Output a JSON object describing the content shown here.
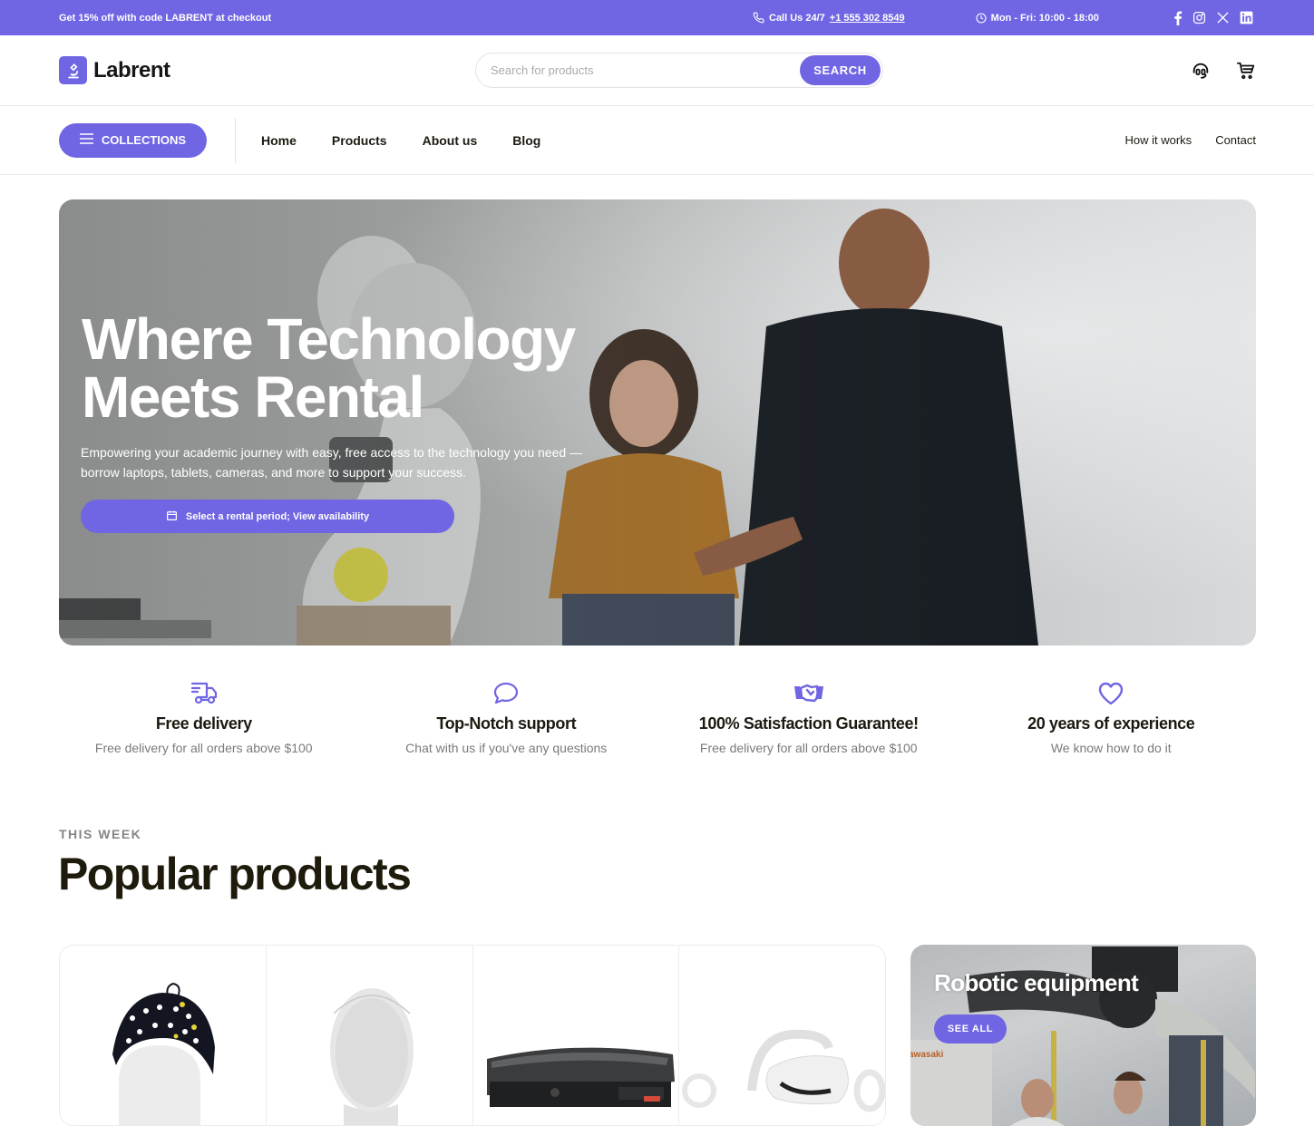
{
  "theme": {
    "accent": "#7065e3",
    "text_dark": "#1c1a10",
    "text_muted": "#7a7a7a"
  },
  "topbar": {
    "promo_prefix": "Get 15% off with code ",
    "promo_code": "LABRENT",
    "promo_suffix": " at checkout",
    "call_label": "Call Us 24/7",
    "phone": "+1 555 302 8549",
    "hours": "Mon - Fri: 10:00 - 18:00",
    "socials": [
      "facebook-icon",
      "instagram-icon",
      "x-icon",
      "linkedin-icon"
    ]
  },
  "header": {
    "brand": "Labrent",
    "search_placeholder": "Search for products",
    "search_value": "",
    "search_button": "SEARCH",
    "icons": [
      "support-headset-icon",
      "cart-icon"
    ]
  },
  "nav": {
    "collections_label": "COLLECTIONS",
    "links": [
      "Home",
      "Products",
      "About us",
      "Blog"
    ],
    "right_links": [
      "How it works",
      "Contact"
    ]
  },
  "hero": {
    "title_line1": "Where Technology",
    "title_line2": "Meets Rental",
    "subtitle": "Empowering your academic journey with easy, free access to the technology you need — borrow laptops, tablets, cameras, and more to support your success.",
    "cta_label": "Select a rental period; View availability"
  },
  "features": [
    {
      "icon": "delivery-truck-icon",
      "title": "Free delivery",
      "text": "Free delivery for all orders above $100"
    },
    {
      "icon": "chat-bubble-icon",
      "title": "Top-Notch support",
      "text": "Chat with us if you've any questions"
    },
    {
      "icon": "handshake-icon",
      "title": "100% Satisfaction Guarantee!",
      "text": "Free delivery for all orders above $100"
    },
    {
      "icon": "heart-icon",
      "title": "20 years of experience",
      "text": "We know how to do it"
    }
  ],
  "popular": {
    "eyebrow": "THIS WEEK",
    "title": "Popular products",
    "products": [
      {
        "image": "eeg-cap-on-mannequin"
      },
      {
        "image": "white-mannequin-head"
      },
      {
        "image": "mixed-reality-headset"
      },
      {
        "image": "vr-headset-with-controllers"
      }
    ],
    "promo_card": {
      "title": "Robotic equipment",
      "button": "SEE ALL"
    }
  }
}
